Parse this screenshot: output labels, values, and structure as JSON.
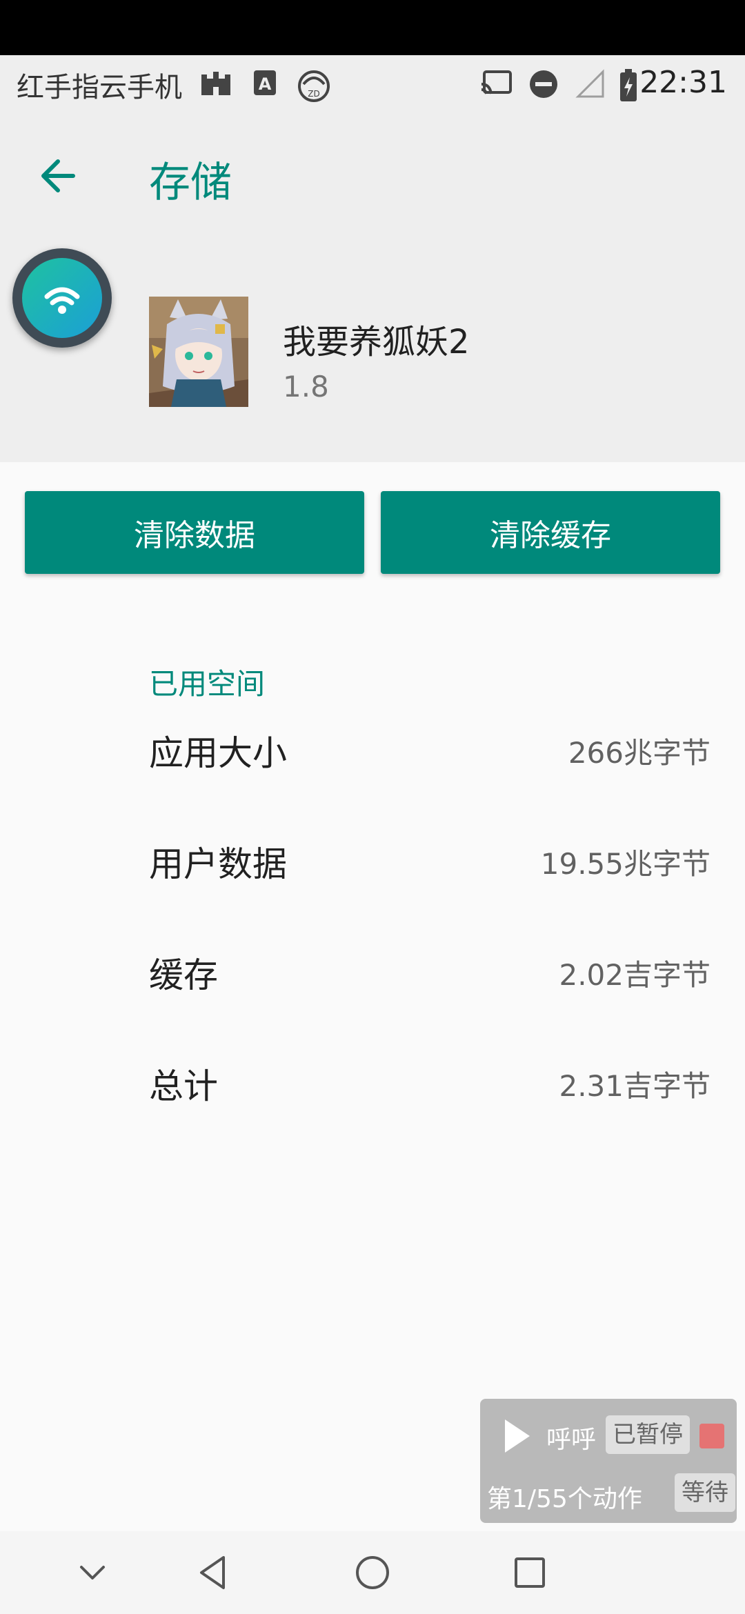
{
  "status_bar": {
    "carrier": "红手指云手机",
    "time": "22:31",
    "icons": [
      "castle-icon",
      "a-icon",
      "zd-icon",
      "cast-icon",
      "dnd-icon",
      "signal-icon",
      "battery-icon"
    ]
  },
  "header": {
    "title": "存储",
    "back_icon": "arrow-left-icon",
    "app_name": "我要养狐妖2",
    "app_version": "1.8"
  },
  "floating_button": {
    "icon": "wifi-icon"
  },
  "actions": {
    "clear_data": "清除数据",
    "clear_cache": "清除缓存"
  },
  "storage": {
    "section_title": "已用空间",
    "rows": [
      {
        "label": "应用大小",
        "value": "266兆字节"
      },
      {
        "label": "用户数据",
        "value": "19.55兆字节"
      },
      {
        "label": "缓存",
        "value": "2.02吉字节"
      },
      {
        "label": "总计",
        "value": "2.31吉字节"
      }
    ]
  },
  "macro_overlay": {
    "name": "呼呼",
    "status": "已暂停",
    "progress": "第1/55个动作",
    "wait": "等待"
  },
  "nav_bar": {
    "buttons": [
      "chevron-down-icon",
      "back-triangle-icon",
      "home-circle-icon",
      "recents-square-icon"
    ]
  },
  "colors": {
    "accent": "#00897b",
    "header_bg": "#eeeeee",
    "page_bg": "#fafafa"
  }
}
